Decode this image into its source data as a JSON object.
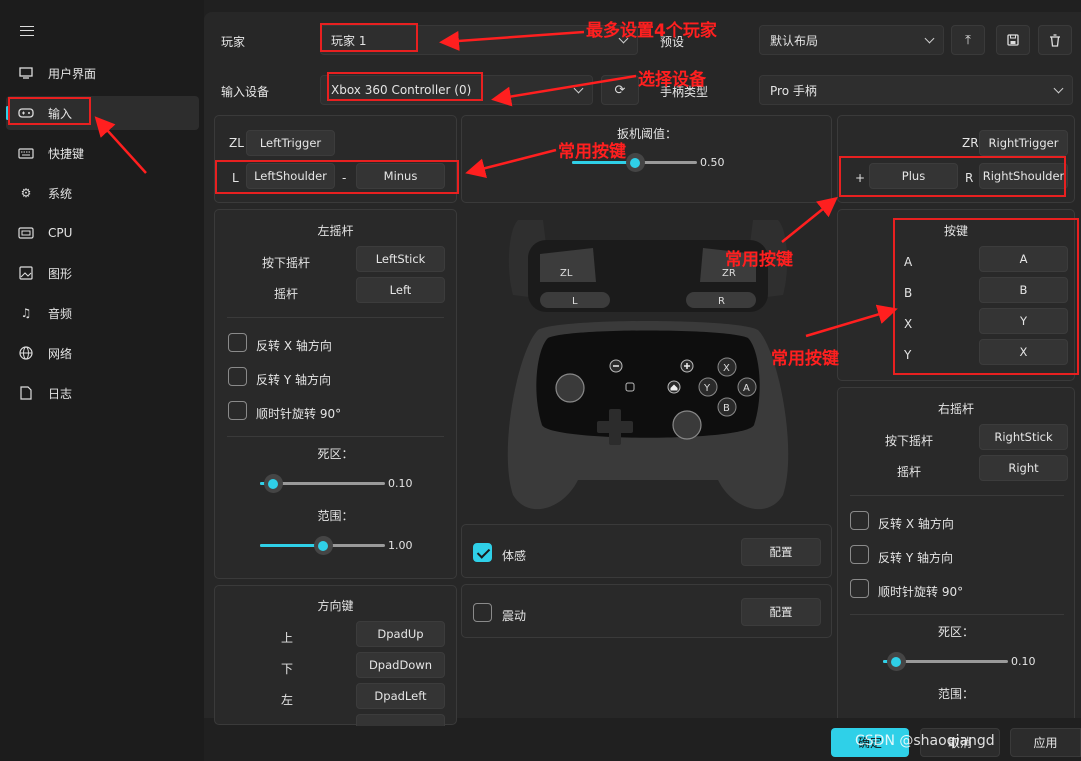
{
  "sidebar": {
    "items": [
      {
        "label": "用户界面",
        "icon": "monitor-icon"
      },
      {
        "label": "输入",
        "icon": "gamepad-icon",
        "selected": true
      },
      {
        "label": "快捷键",
        "icon": "keyboard-icon"
      },
      {
        "label": "系统",
        "icon": "gear-icon"
      },
      {
        "label": "CPU",
        "icon": "cpu-icon"
      },
      {
        "label": "图形",
        "icon": "image-icon"
      },
      {
        "label": "音频",
        "icon": "music-icon"
      },
      {
        "label": "网络",
        "icon": "globe-icon"
      },
      {
        "label": "日志",
        "icon": "document-icon"
      }
    ]
  },
  "top": {
    "player_label": "玩家",
    "player_value": "玩家 1",
    "preset_label": "预设",
    "preset_value": "默认布局",
    "device_label": "输入设备",
    "device_value": "Xbox 360 Controller (0)",
    "controller_type_label": "手柄类型",
    "controller_type_value": "Pro 手柄"
  },
  "left_triggers": {
    "zl_label": "ZL",
    "zl_btn": "LeftTrigger",
    "l_label": "L",
    "l_btn": "LeftShoulder",
    "minus_label": "-",
    "minus_btn": "Minus"
  },
  "right_triggers": {
    "zr_label": "ZR",
    "zr_btn": "RightTrigger",
    "plus_label": "+",
    "plus_btn": "Plus",
    "r_label": "R",
    "r_btn": "RightShoulder"
  },
  "trigger_threshold": {
    "label": "扳机阈值：",
    "value": "0.50",
    "fraction": 0.5
  },
  "left_stick": {
    "title": "左摇杆",
    "press_label": "按下摇杆",
    "press_btn": "LeftStick",
    "stick_label": "摇杆",
    "stick_btn": "Left",
    "invert_x": "反转 X 轴方向",
    "invert_y": "反转 Y 轴方向",
    "rotate": "顺时针旋转 90°",
    "deadzone_label": "死区：",
    "deadzone_value": "0.10",
    "deadzone_fraction": 0.1,
    "range_label": "范围：",
    "range_value": "1.00",
    "range_fraction": 0.5
  },
  "dpad": {
    "title": "方向键",
    "up_label": "上",
    "up_btn": "DpadUp",
    "down_label": "下",
    "down_btn": "DpadDown",
    "left_label": "左",
    "left_btn": "DpadLeft"
  },
  "buttons": {
    "title": "按键",
    "rows": [
      {
        "label": "A",
        "btn": "A"
      },
      {
        "label": "B",
        "btn": "B"
      },
      {
        "label": "X",
        "btn": "Y"
      },
      {
        "label": "Y",
        "btn": "X"
      }
    ]
  },
  "right_stick": {
    "title": "右摇杆",
    "press_label": "按下摇杆",
    "press_btn": "RightStick",
    "stick_label": "摇杆",
    "stick_btn": "Right",
    "invert_x": "反转 X 轴方向",
    "invert_y": "反转 Y 轴方向",
    "rotate": "顺时针旋转 90°",
    "deadzone_label": "死区：",
    "deadzone_value": "0.10",
    "deadzone_fraction": 0.1,
    "range_label": "范围："
  },
  "motion": {
    "label": "体感",
    "config": "配置",
    "checked": true
  },
  "rumble": {
    "label": "震动",
    "config": "配置",
    "checked": false
  },
  "controller_graphic": {
    "zl": "ZL",
    "zr": "ZR",
    "l": "L",
    "r": "R",
    "x": "X",
    "y": "Y",
    "a": "A",
    "b": "B"
  },
  "footer": {
    "ok": "确定",
    "cancel": "取消",
    "apply": "应用"
  },
  "watermark": "CSDN @shaoqiangd",
  "annotations": {
    "max_players": "最多设置4个玩家",
    "select_device": "选择设备",
    "common_keys_1": "常用按键",
    "common_keys_2": "常用按键",
    "common_keys_3": "常用按键"
  },
  "colors": {
    "accent": "#2fd0e8",
    "annotation": "#ff1f1f"
  }
}
